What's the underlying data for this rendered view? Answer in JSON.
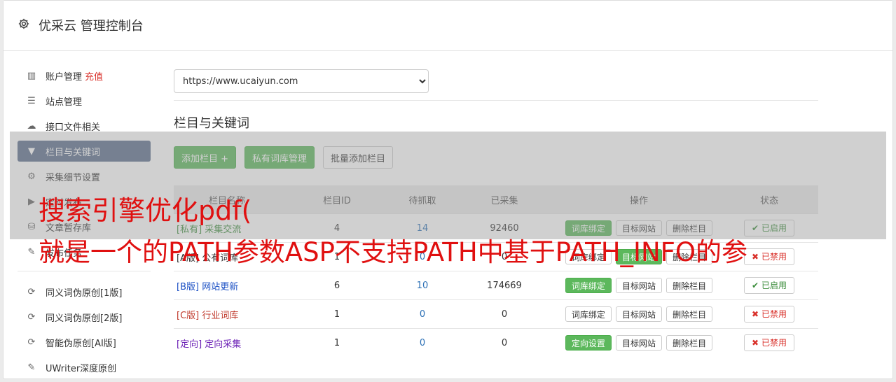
{
  "header": {
    "title": "优采云 管理控制台",
    "icon": "gear-icon"
  },
  "sidebar": {
    "items": [
      {
        "label": "账户管理",
        "icon": "bar-chart-icon",
        "extra": "充值"
      },
      {
        "label": "站点管理",
        "icon": "server-icon"
      },
      {
        "label": "接口文件相关",
        "icon": "cloud-upload-icon"
      },
      {
        "label": "栏目与关键词",
        "icon": "filter-icon",
        "active": true
      },
      {
        "label": "采集细节设置",
        "icon": "cogs-icon"
      },
      {
        "label": "定时发布",
        "icon": "play-circle-icon"
      },
      {
        "label": "文章暂存库",
        "icon": "database-icon"
      },
      {
        "label": "发布任务",
        "icon": "edit-icon"
      }
    ],
    "tools": [
      {
        "label": "同义词伪原创[1版]",
        "icon": "refresh-icon"
      },
      {
        "label": "同义词伪原创[2版]",
        "icon": "refresh-icon"
      },
      {
        "label": "智能伪原创[AI版]",
        "icon": "refresh-icon"
      },
      {
        "label": "UWriter深度原创",
        "icon": "edit-icon"
      }
    ]
  },
  "main": {
    "site_select": "https://www.ucaiyun.com",
    "section_title": "栏目与关键词",
    "buttons": {
      "add_column": "添加栏目 +",
      "private_lib": "私有词库管理",
      "batch_add": "批量添加栏目"
    },
    "table": {
      "headers": [
        "栏目名称",
        "栏目ID",
        "待抓取",
        "已采集",
        "操作",
        "状态"
      ],
      "rows": [
        {
          "prefix": "[私有]",
          "name": "采集交流",
          "id": "4",
          "pending": "14",
          "collected": "92460",
          "action1": "词库绑定",
          "action1_green": true,
          "action2": "目标网站",
          "action2_green": false,
          "action3": "删除栏目",
          "status": "已启用",
          "status_on": true,
          "color": "#3c8d3c"
        },
        {
          "prefix": "[A版]",
          "name": "公有词库",
          "id": "1",
          "pending": "0",
          "collected": "0",
          "action1": "词库绑定",
          "action1_green": false,
          "action2": "目标网站",
          "action2_green": true,
          "action3": "删除栏目",
          "status": "已禁用",
          "status_on": false,
          "color": "#333333"
        },
        {
          "prefix": "[B版]",
          "name": "网站更新",
          "id": "6",
          "pending": "10",
          "collected": "174669",
          "action1": "词库绑定",
          "action1_green": true,
          "action2": "目标网站",
          "action2_green": false,
          "action3": "删除栏目",
          "status": "已启用",
          "status_on": true,
          "color": "#1a4fc4"
        },
        {
          "prefix": "[C版]",
          "name": "行业词库",
          "id": "1",
          "pending": "0",
          "collected": "0",
          "action1": "词库绑定",
          "action1_green": false,
          "action2": "目标网站",
          "action2_green": false,
          "action3": "删除栏目",
          "status": "已禁用",
          "status_on": false,
          "color": "#c0392b"
        },
        {
          "prefix": "[定向]",
          "name": "定向采集",
          "id": "1",
          "pending": "0",
          "collected": "0",
          "action1": "定向设置",
          "action1_green": true,
          "action2": "目标网站",
          "action2_green": false,
          "action3": "删除栏目",
          "status": "已禁用",
          "status_on": false,
          "color": "#6a1fb5"
        }
      ]
    }
  },
  "overlay": {
    "line1": "搜索引擎优化pdf(",
    "line2": "就是一个的PATH参数ASP不支持PATH中基于PATH_INFO的参"
  }
}
